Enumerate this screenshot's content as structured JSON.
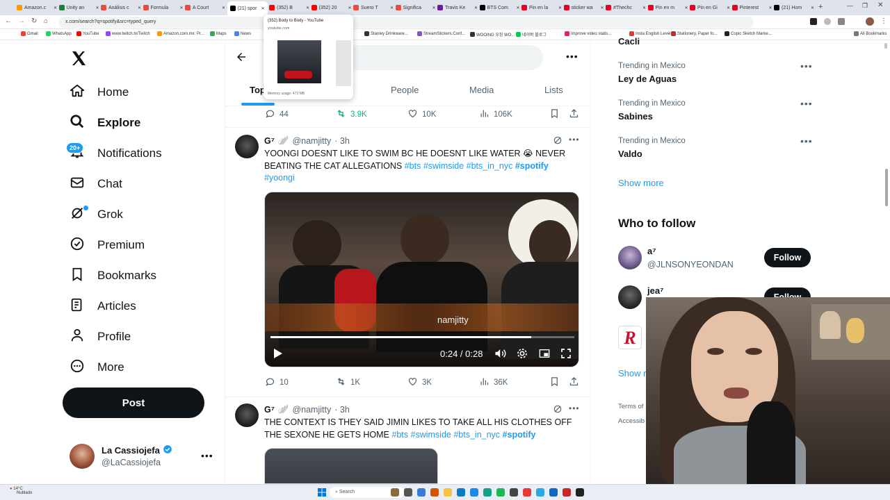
{
  "browser": {
    "tabs": [
      {
        "label": "Amazon.c",
        "color": "#ff9900"
      },
      {
        "label": "Unity an",
        "color": "#1b7f3b"
      },
      {
        "label": "Análisis c",
        "color": "#e74c3c"
      },
      {
        "label": "Formula",
        "color": "#e74c3c"
      },
      {
        "label": "A Court",
        "color": "#e74c3c"
      },
      {
        "label": "(21) spor",
        "color": "#000000",
        "active": true
      },
      {
        "label": "(352) B",
        "color": "#ff0000"
      },
      {
        "label": "(352) 20",
        "color": "#ff0000"
      },
      {
        "label": "Suero T",
        "color": "#e74c3c"
      },
      {
        "label": "Significa",
        "color": "#e74c3c"
      },
      {
        "label": "Travis Ke",
        "color": "#6a1b9a"
      },
      {
        "label": "BTS Com",
        "color": "#000000"
      },
      {
        "label": "Pin en la",
        "color": "#e60023"
      },
      {
        "label": "sticker wa",
        "color": "#e60023"
      },
      {
        "label": "#Thechc",
        "color": "#e60023"
      },
      {
        "label": "Pin en m",
        "color": "#e60023"
      },
      {
        "label": "Pin en Gi",
        "color": "#e60023"
      },
      {
        "label": "Pinterest",
        "color": "#e60023"
      },
      {
        "label": "(21) Hom",
        "color": "#000000"
      }
    ],
    "url": "x.com/search?q=spotify&src=typed_query",
    "bookmarks": [
      {
        "label": "Gmail",
        "color": "#ea4335"
      },
      {
        "label": "WhatsApp",
        "color": "#25d366"
      },
      {
        "label": "YouTube",
        "color": "#ff0000"
      },
      {
        "label": "www.twitch.tv/Twitch",
        "color": "#9146ff"
      },
      {
        "label": "Amazon.com.mx: Pr...",
        "color": "#ff9900"
      },
      {
        "label": "Maps",
        "color": "#34a853"
      },
      {
        "label": "News",
        "color": "#4285f4"
      },
      {
        "label": "Stanley Drinkware...",
        "color": "#333333"
      },
      {
        "label": "StreamStickers.Conf...",
        "color": "#7e57c2"
      },
      {
        "label": "WOOING 우징 WO...",
        "color": "#333333"
      },
      {
        "label": "네이버 블로그",
        "color": "#03c75a"
      },
      {
        "label": "Improve video statis...",
        "color": "#e91e63"
      },
      {
        "label": "Insta English Level 1...",
        "color": "#e53935"
      },
      {
        "label": "Stationery, Paper fo...",
        "color": "#c62828"
      },
      {
        "label": "Copic Sketch Marke...",
        "color": "#212121"
      }
    ],
    "all_bookmarks": "All Bookmarks",
    "tab_preview": {
      "title": "(352) Body to Body - YouTube",
      "domain": "youtube.com",
      "memory": "Memory usage: 473 MB"
    }
  },
  "nav": {
    "items": [
      {
        "label": "Home",
        "icon": "home-icon",
        "bold": false
      },
      {
        "label": "Explore",
        "icon": "search-icon",
        "bold": true
      },
      {
        "label": "Notifications",
        "icon": "bell-icon",
        "bold": false
      },
      {
        "label": "Chat",
        "icon": "mail-icon",
        "bold": false
      },
      {
        "label": "Grok",
        "icon": "grok-icon",
        "bold": false
      },
      {
        "label": "Premium",
        "icon": "verified-icon",
        "bold": false
      },
      {
        "label": "Bookmarks",
        "icon": "bookmark-icon",
        "bold": false
      },
      {
        "label": "Articles",
        "icon": "article-icon",
        "bold": false
      },
      {
        "label": "Profile",
        "icon": "person-icon",
        "bold": false
      },
      {
        "label": "More",
        "icon": "more-circle-icon",
        "bold": false
      }
    ],
    "notif_badge": "20+",
    "post_label": "Post",
    "account": {
      "name": "La Cassiojefa",
      "handle": "@LaCassiojefa"
    }
  },
  "search": {
    "tabs": [
      "Top",
      "People",
      "Media",
      "Lists"
    ],
    "active_tab": "Top"
  },
  "tweets": [
    {
      "actions": {
        "replies": "44",
        "retweets": "3.9K",
        "likes": "10K",
        "views": "106K"
      }
    },
    {
      "name": "G⁷",
      "emoji": "🪽",
      "handle": "@namjitty",
      "time": "· 3h",
      "text_plain": "YOONGI DOESNT LIKE TO SWIM BC HE DOESNT LIKE WATER 😭 NEVER BEATING THE CAT ALLEGATIONS ",
      "tags": [
        "#bts",
        "#swimside",
        "#bts_in_nyc"
      ],
      "tag_bold": "#spotify",
      "tag_last": "#yoongi",
      "video": {
        "watermark": "namjitty",
        "time": "0:24 / 0:28",
        "progress": 0.857
      },
      "actions": {
        "replies": "10",
        "retweets": "1K",
        "likes": "3K",
        "views": "36K"
      }
    },
    {
      "name": "G⁷",
      "emoji": "🪽",
      "handle": "@namjitty",
      "time": "· 3h",
      "text_plain": "THE CONTEXT IS THEY SAID JIMIN LIKES TO TAKE ALL HIS CLOTHES OFF THE SEXONE HE GETS HOME ",
      "tags": [
        "#bts",
        "#swimside",
        "#bts_in_nyc"
      ],
      "tag_bold": "#spotify"
    }
  ],
  "trends": [
    {
      "sub": "",
      "title": "Cacli"
    },
    {
      "sub": "Trending in Mexico",
      "title": "Ley de Aguas"
    },
    {
      "sub": "Trending in Mexico",
      "title": "Sabines"
    },
    {
      "sub": "Trending in Mexico",
      "title": "Valdo"
    }
  ],
  "show_more": "Show more",
  "who_to_follow": {
    "title": "Who to follow",
    "users": [
      {
        "name": "a⁷",
        "handle": "@JLNSONYEONDAN",
        "button": "Follow"
      },
      {
        "name": "jea⁷",
        "handle": "",
        "button": "Follow"
      },
      {
        "name": "",
        "handle": "",
        "button": ""
      }
    ],
    "show_more": "Show m"
  },
  "footer": {
    "terms": "Terms of",
    "access": "Accessib"
  },
  "taskbar": {
    "weather_temp": "14°C",
    "weather_desc": "Nublado",
    "search": "Search"
  }
}
